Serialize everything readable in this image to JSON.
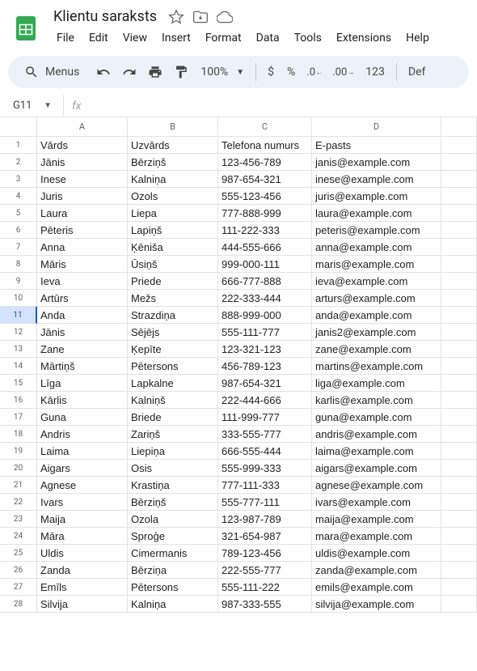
{
  "doc": {
    "title": "Klientu saraksts"
  },
  "menus": [
    "File",
    "Edit",
    "View",
    "Insert",
    "Format",
    "Data",
    "Tools",
    "Extensions",
    "Help"
  ],
  "toolbar": {
    "menus_label": "Menus",
    "zoom": "100%",
    "currency": "$",
    "percent": "%",
    "decrease_dec": ".0",
    "increase_dec": ".00",
    "num_format": "123",
    "font_default": "Def"
  },
  "namebox": "G11",
  "columns": [
    "A",
    "B",
    "C",
    "D",
    ""
  ],
  "headers": [
    "Vārds",
    "Uzvārds",
    "Telefona numurs",
    "E-pasts"
  ],
  "rows": [
    [
      "Jānis",
      "Bērziņš",
      "123-456-789",
      "janis@example.com"
    ],
    [
      "Inese",
      "Kalniņa",
      "987-654-321",
      "inese@example.com"
    ],
    [
      "Juris",
      "Ozols",
      "555-123-456",
      "juris@example.com"
    ],
    [
      "Laura",
      "Liepa",
      "777-888-999",
      "laura@example.com"
    ],
    [
      "Pēteris",
      "Lapiņš",
      "111-222-333",
      "peteris@example.com"
    ],
    [
      "Anna",
      "Ķēniša",
      "444-555-666",
      "anna@example.com"
    ],
    [
      "Māris",
      "Ūsiņš",
      "999-000-111",
      "maris@example.com"
    ],
    [
      "Ieva",
      "Priede",
      "666-777-888",
      "ieva@example.com"
    ],
    [
      "Artūrs",
      "Mežs",
      "222-333-444",
      "arturs@example.com"
    ],
    [
      "Anda",
      "Strazdiņa",
      "888-999-000",
      "anda@example.com"
    ],
    [
      "Jānis",
      "Sējējs",
      "555-111-777",
      "janis2@example.com"
    ],
    [
      "Zane",
      "Ķepīte",
      "123-321-123",
      "zane@example.com"
    ],
    [
      "Mārtiņš",
      "Pētersons",
      "456-789-123",
      "martins@example.com"
    ],
    [
      "Līga",
      "Lapkalne",
      "987-654-321",
      "liga@example.com"
    ],
    [
      "Kārlis",
      "Kalniņš",
      "222-444-666",
      "karlis@example.com"
    ],
    [
      "Guna",
      "Briede",
      "111-999-777",
      "guna@example.com"
    ],
    [
      "Andris",
      "Zariņš",
      "333-555-777",
      "andris@example.com"
    ],
    [
      "Laima",
      "Liepiņa",
      "666-555-444",
      "laima@example.com"
    ],
    [
      "Aigars",
      "Osis",
      "555-999-333",
      "aigars@example.com"
    ],
    [
      "Agnese",
      "Krastiņa",
      "777-111-333",
      "agnese@example.com"
    ],
    [
      "Ivars",
      "Bērziņš",
      "555-777-111",
      "ivars@example.com"
    ],
    [
      "Maija",
      "Ozola",
      "123-987-789",
      "maija@example.com"
    ],
    [
      "Māra",
      "Sproģe",
      "321-654-987",
      "mara@example.com"
    ],
    [
      "Uldis",
      "Cimermanis",
      "789-123-456",
      "uldis@example.com"
    ],
    [
      "Zanda",
      "Bērziņa",
      "222-555-777",
      "zanda@example.com"
    ],
    [
      "Emīls",
      "Pētersons",
      "555-111-222",
      "emils@example.com"
    ],
    [
      "Silvija",
      "Kalniņa",
      "987-333-555",
      "silvija@example.com"
    ]
  ],
  "selected_row": 11
}
